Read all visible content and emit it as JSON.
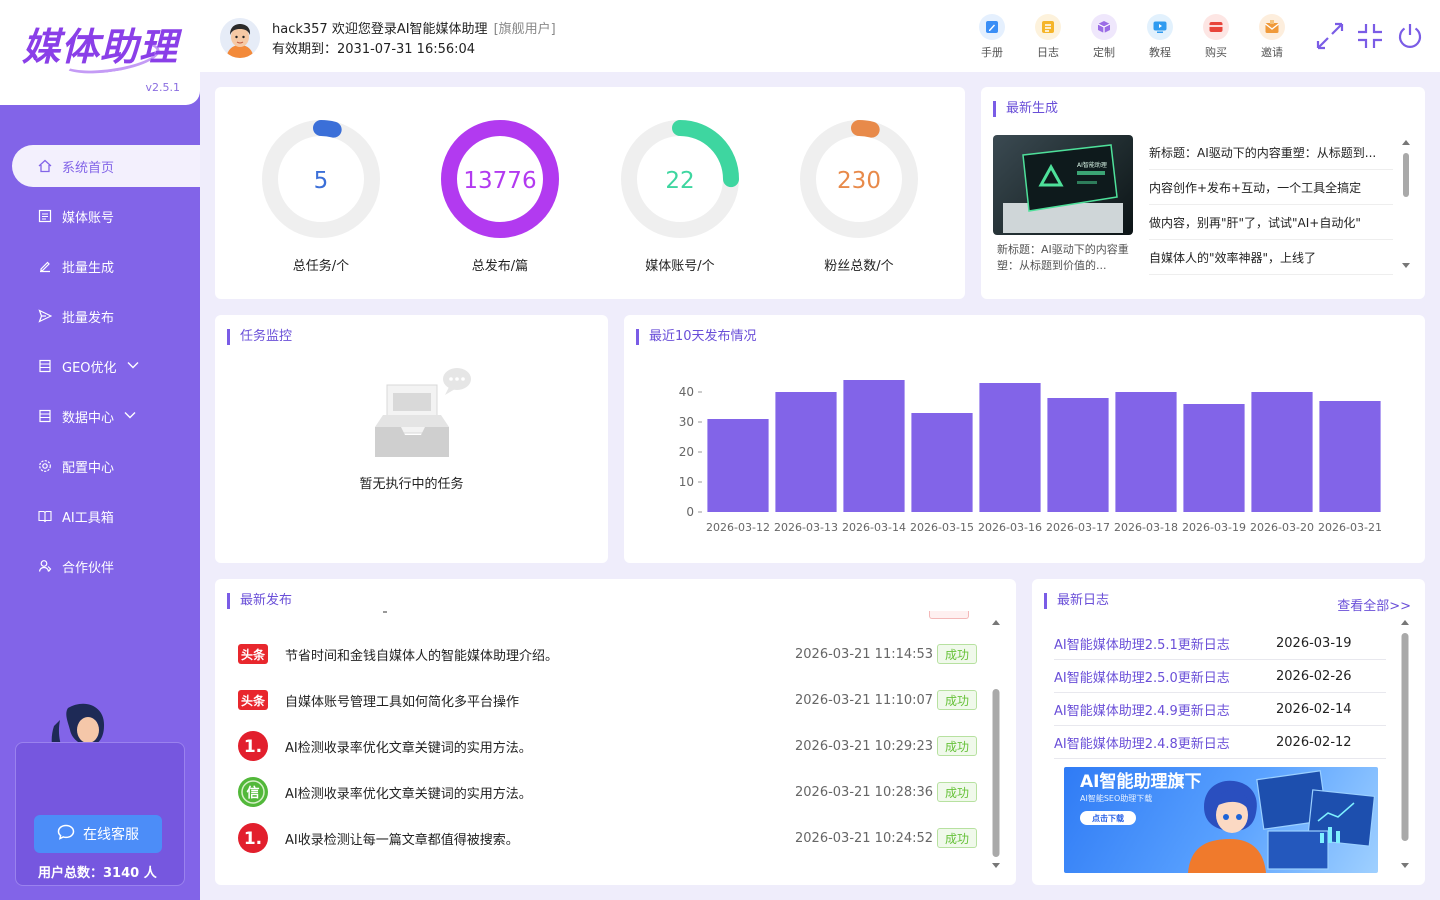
{
  "app": {
    "logo": "媒体助理",
    "version": "v2.5.1"
  },
  "sidebar": {
    "items": [
      {
        "label": "系统首页",
        "icon": "home-icon"
      },
      {
        "label": "媒体账号",
        "icon": "account-icon"
      },
      {
        "label": "批量生成",
        "icon": "edit-icon"
      },
      {
        "label": "批量发布",
        "icon": "send-icon"
      },
      {
        "label": "GEO优化",
        "icon": "list-icon"
      },
      {
        "label": "数据中心",
        "icon": "list-icon"
      },
      {
        "label": "配置中心",
        "icon": "gear-icon"
      },
      {
        "label": "AI工具箱",
        "icon": "book-icon"
      },
      {
        "label": "合作伙伴",
        "icon": "partner-icon"
      }
    ],
    "support_label": "在线客服",
    "user_count_text": "用户总数：3140 人"
  },
  "header": {
    "welcome": "hack357 欢迎您登录AI智能媒体助理",
    "user_tag": "[旗舰用户]",
    "expire": "有效期到：2031-07-31 16:56:04",
    "tools": [
      {
        "label": "手册",
        "color": "#3a8ef6"
      },
      {
        "label": "日志",
        "color": "#f5b52a"
      },
      {
        "label": "定制",
        "color": "#9b6ce6"
      },
      {
        "label": "教程",
        "color": "#2f9bf0"
      },
      {
        "label": "购买",
        "color": "#e8443a"
      },
      {
        "label": "邀请",
        "color": "#f09a3a"
      }
    ]
  },
  "stats": [
    {
      "value": "5",
      "label": "总任务/个",
      "color": "#3b6fd8",
      "fraction": 0.04
    },
    {
      "value": "13776",
      "label": "总发布/篇",
      "color": "#b23af0",
      "fraction": 1.0
    },
    {
      "value": "22",
      "label": "媒体账号/个",
      "color": "#3ed6a0",
      "fraction": 0.25
    },
    {
      "value": "230",
      "label": "粉丝总数/个",
      "color": "#e88a4a",
      "fraction": 0.04
    }
  ],
  "latest_gen": {
    "title": "最新生成",
    "thumb_caption": "新标题：AI驱动下的内容重塑：从标题到价值的...",
    "thumb_text": "AI智能助理",
    "items": [
      "新标题：AI驱动下的内容重塑：从标题到...",
      "内容创作+发布+互动，一个工具全搞定",
      "做内容，别再\"肝\"了，试试\"AI+自动化\"",
      "自媒体人的\"效率神器\"，上线了"
    ]
  },
  "task_monitor": {
    "title": "任务监控",
    "empty_text": "暂无执行中的任务"
  },
  "chart_title": "最近10天发布情况",
  "chart_data": {
    "type": "bar",
    "categories": [
      "2026-03-12",
      "2026-03-13",
      "2026-03-14",
      "2026-03-15",
      "2026-03-16",
      "2026-03-17",
      "2026-03-18",
      "2026-03-19",
      "2026-03-20",
      "2026-03-21"
    ],
    "values": [
      31,
      40,
      44,
      33,
      43,
      38,
      40,
      36,
      40,
      37
    ],
    "ylim": [
      0,
      45
    ],
    "yticks": [
      0,
      10,
      20,
      30,
      40
    ],
    "color": "#8264e8"
  },
  "latest_pub": {
    "title": "最新发布",
    "rows": [
      {
        "icon": "toutiao-icon",
        "icon_text": "头条",
        "title": "节省时间和金钱自媒体人的智能媒体助理介绍。",
        "time": "2026-03-21 11:14:53",
        "status": "成功"
      },
      {
        "icon": "toutiao-icon",
        "icon_text": "头条",
        "title": "自媒体账号管理工具如何简化多平台操作",
        "time": "2026-03-21 11:10:07",
        "status": "成功"
      },
      {
        "icon": "number-one-icon",
        "icon_text": "1.",
        "title": "AI检测收录率优化文章关键词的实用方法。",
        "time": "2026-03-21 10:29:23",
        "status": "成功"
      },
      {
        "icon": "green-badge-icon",
        "icon_text": "信",
        "title": "AI检测收录率优化文章关键词的实用方法。",
        "time": "2026-03-21 10:28:36",
        "status": "成功"
      },
      {
        "icon": "number-one-icon",
        "icon_text": "1.",
        "title": "AI收录检测让每一篇文章都值得被搜索。",
        "time": "2026-03-21 10:24:52",
        "status": "成功"
      }
    ]
  },
  "latest_log": {
    "title": "最新日志",
    "view_all": "查看全部>>",
    "rows": [
      {
        "title": "AI智能媒体助理2.5.1更新日志",
        "date": "2026-03-19"
      },
      {
        "title": "AI智能媒体助理2.5.0更新日志",
        "date": "2026-02-26"
      },
      {
        "title": "AI智能媒体助理2.4.9更新日志",
        "date": "2026-02-14"
      },
      {
        "title": "AI智能媒体助理2.4.8更新日志",
        "date": "2026-02-12"
      }
    ],
    "banner": {
      "title": "AI智能助理旗下",
      "subtitle": "AI智能SEO助理下载",
      "button": "点击下载"
    }
  }
}
